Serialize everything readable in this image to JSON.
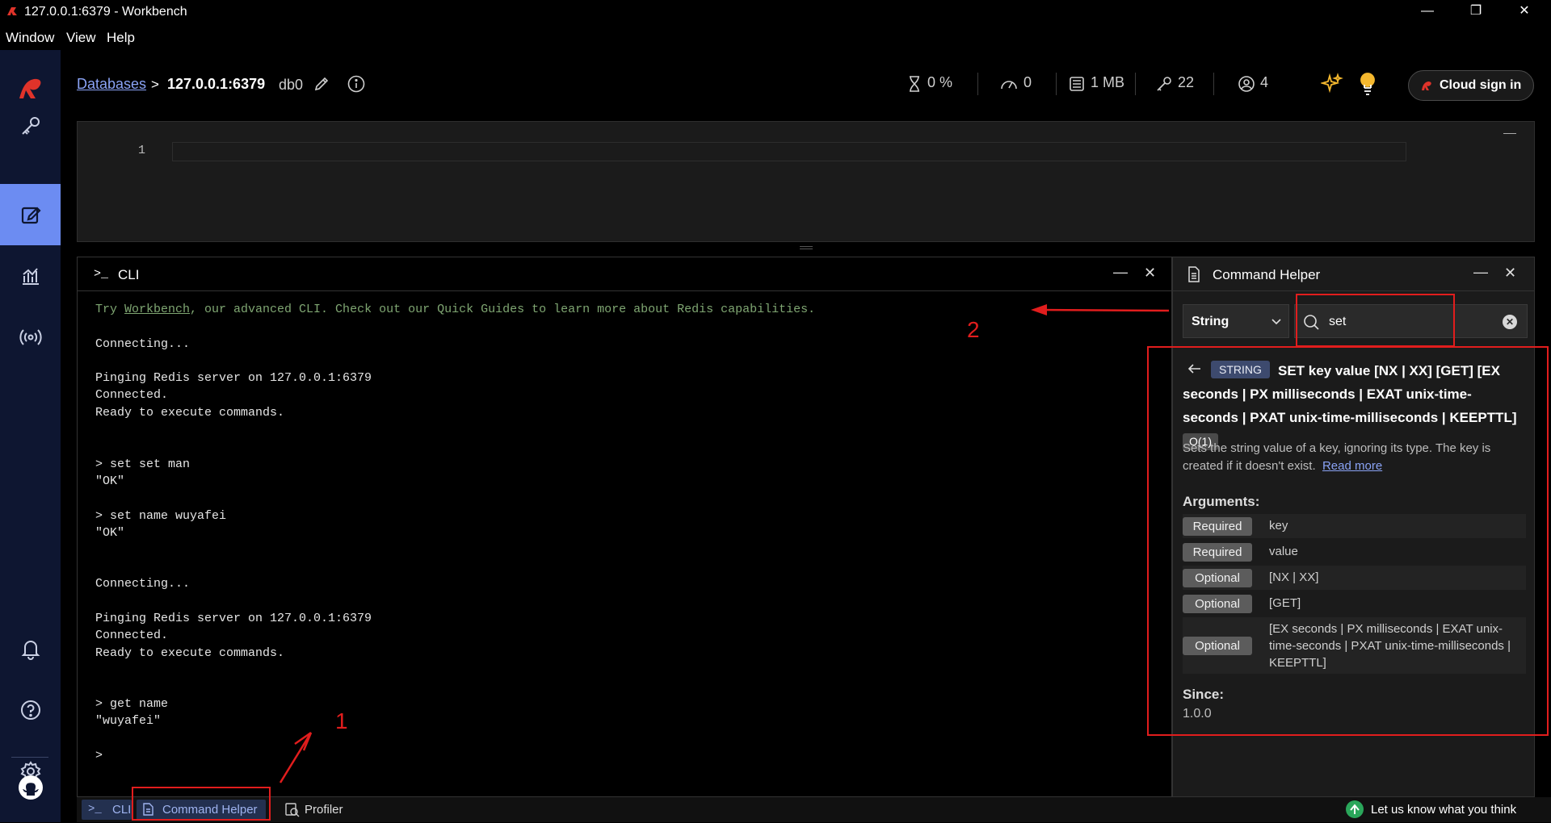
{
  "window": {
    "title": "127.0.0.1:6379 - Workbench",
    "minimize": "—",
    "maximize": "❐",
    "close": "✕"
  },
  "menu": [
    "Window",
    "View",
    "Help"
  ],
  "header": {
    "breadcrumb_databases": "Databases",
    "breadcrumb_sep": ">",
    "host": "127.0.0.1:6379",
    "db": "db0",
    "stats": {
      "cpu": "0 %",
      "ops": "0",
      "memory": "1 MB",
      "keys": "22",
      "clients": "4"
    },
    "cloud_signin": "Cloud sign in"
  },
  "editor": {
    "line_number": "1"
  },
  "cli": {
    "title": "CLI",
    "prompt_icon": ">_",
    "intro_try": "Try ",
    "intro_link": "Workbench",
    "intro_rest": ", our advanced CLI. Check out our Quick Guides to learn more about Redis capabilities.",
    "lines": [
      "Connecting...",
      "Pinging Redis server on 127.0.0.1:6379",
      "Connected.",
      "Ready to execute commands.",
      "> set set man",
      "\"OK\"",
      "> set name wuyafei",
      "\"OK\"",
      "Connecting...",
      "Pinging Redis server on 127.0.0.1:6379",
      "Connected.",
      "Ready to execute commands.",
      "> get name",
      "\"wuyafei\"",
      ">"
    ]
  },
  "helper": {
    "title": "Command Helper",
    "group_select": "String",
    "search_value": "set",
    "tag": "STRING",
    "syntax": "SET key value [NX | XX] [GET] [EX seconds | PX milliseconds | EXAT unix-time-seconds | PXAT unix-time-milliseconds | KEEPTTL]",
    "complexity": "O(1)",
    "description": "Sets the string value of a key, ignoring its type. The key is created if it doesn't exist.",
    "read_more": "Read more",
    "arguments_label": "Arguments:",
    "arguments": [
      {
        "badge": "Required",
        "text": "key"
      },
      {
        "badge": "Required",
        "text": "value"
      },
      {
        "badge": "Optional",
        "text": "[NX | XX]"
      },
      {
        "badge": "Optional",
        "text": "[GET]"
      },
      {
        "badge": "Optional",
        "text": "[EX seconds | PX milliseconds | EXAT unix-time-seconds | PXAT unix-time-milliseconds | KEEPTTL]"
      }
    ],
    "since_label": "Since:",
    "since_value": "1.0.0"
  },
  "bottombar": {
    "cli_tab": "CLI",
    "helper_tab": "Command Helper",
    "profiler_tab": "Profiler",
    "feedback": "Let us know what you think"
  },
  "annotations": {
    "one": "1",
    "two": "2"
  },
  "colors": {
    "accent": "#6c8cf2",
    "nav_bg": "#0e1631",
    "brand_red": "#e0332a",
    "annotation_red": "#e11d1d",
    "cli_green": "#7fa672"
  }
}
